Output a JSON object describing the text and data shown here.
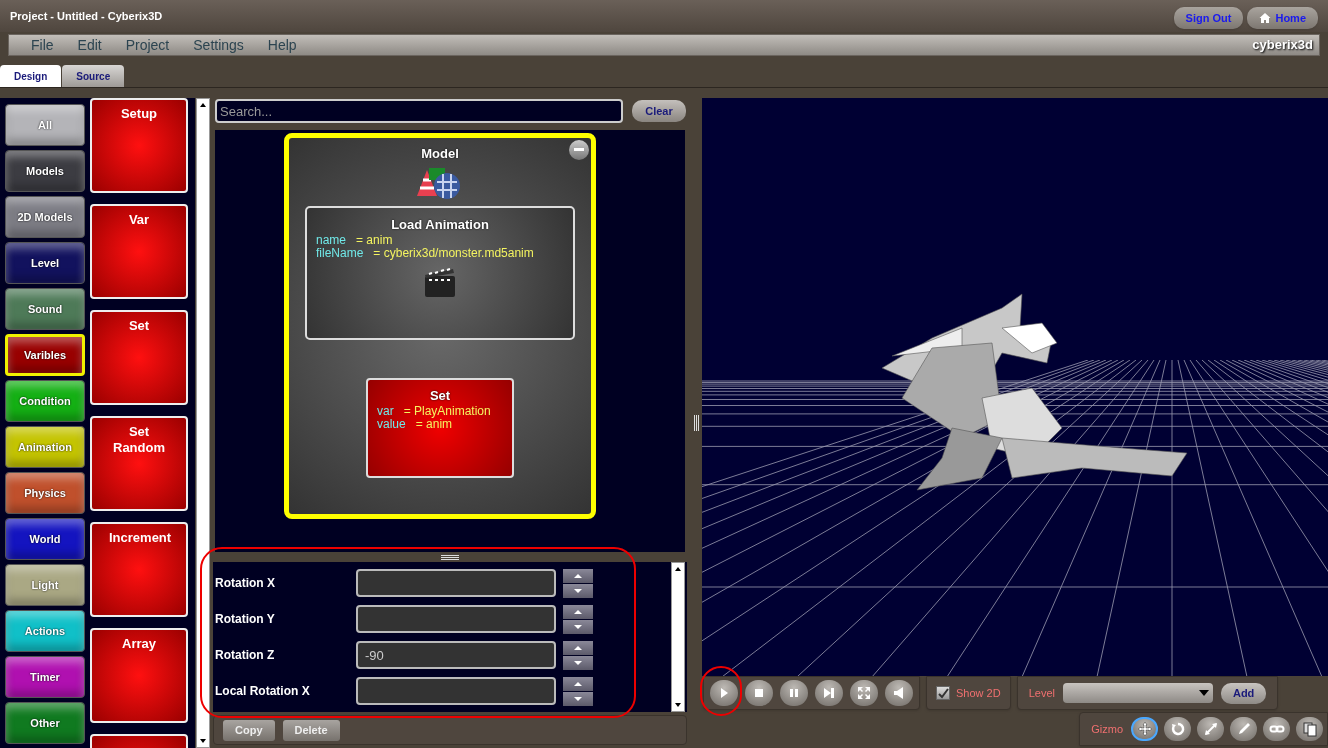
{
  "window": {
    "title": "Project - Untitled - Cyberix3D"
  },
  "header_buttons": [
    {
      "kind": "text",
      "label": "Sign Out"
    },
    {
      "kind": "home",
      "label": "Home"
    }
  ],
  "menu": [
    "File",
    "Edit",
    "Project",
    "Settings",
    "Help"
  ],
  "brand": "cyberix3d",
  "tabs": [
    {
      "label": "Design",
      "selected": true
    },
    {
      "label": "Source",
      "selected": false
    }
  ],
  "categories": [
    {
      "label": "All",
      "color": "#b4b4b8",
      "selected": false
    },
    {
      "label": "Models",
      "color": "#3c3c42",
      "selected": false
    },
    {
      "label": "2D Models",
      "color": "#7c7c84",
      "selected": false
    },
    {
      "label": "Level",
      "color": "#12125e",
      "selected": false
    },
    {
      "label": "Sound",
      "color": "#4e7a58",
      "selected": false
    },
    {
      "label": "Varibles",
      "color": "#990000",
      "selected": true
    },
    {
      "label": "Condition",
      "color": "#14b014",
      "selected": false
    },
    {
      "label": "Animation",
      "color": "#c4c400",
      "selected": false
    },
    {
      "label": "Physics",
      "color": "#c0502c",
      "selected": false
    },
    {
      "label": "World",
      "color": "#1414c0",
      "selected": false
    },
    {
      "label": "Light",
      "color": "#aaa884",
      "selected": false
    },
    {
      "label": "Actions",
      "color": "#10c0c8",
      "selected": false
    },
    {
      "label": "Timer",
      "color": "#b010b0",
      "selected": false
    },
    {
      "label": "Other",
      "color": "#107a20",
      "selected": false
    }
  ],
  "blocks": [
    {
      "title": "Setup"
    },
    {
      "title": "Var"
    },
    {
      "title": "Set"
    },
    {
      "title": "Set Random"
    },
    {
      "title": "Increment"
    },
    {
      "title": "Array"
    }
  ],
  "more_blocks_below": true,
  "search": {
    "placeholder": "Search..."
  },
  "clear_button": "Clear",
  "model": {
    "title": "Model",
    "blocks": [
      {
        "kind": "load",
        "title": "Load Animation",
        "params": [
          {
            "name": "name",
            "op": "=",
            "value": "anim"
          },
          {
            "name": "fileName",
            "op": "=",
            "value": "cyberix3d/monster.md5anim"
          }
        ]
      },
      {
        "kind": "set",
        "title": "Set",
        "params": [
          {
            "name": "var",
            "op": "=",
            "value": "PlayAnimation"
          },
          {
            "name": "value",
            "op": "=",
            "value": "anim"
          }
        ]
      }
    ]
  },
  "properties": [
    {
      "label": "Rotation X"
    },
    {
      "label": "Rotation Y"
    },
    {
      "label": "Rotation Z",
      "value": "-90"
    },
    {
      "label": "Local Rotation X"
    }
  ],
  "actions": [
    "Copy",
    "Delete"
  ],
  "playback": [
    {
      "kind": "play"
    },
    {
      "kind": "stop"
    },
    {
      "kind": "pause"
    },
    {
      "kind": "step"
    },
    {
      "kind": "fullscreen"
    },
    {
      "kind": "sound"
    }
  ],
  "show_2d": {
    "label": "Show 2D",
    "checked": true
  },
  "level": {
    "label": "Level",
    "add_button": "Add"
  },
  "gizmo": {
    "label": "Gizmo",
    "tools": [
      {
        "kind": "move",
        "selected": true
      },
      {
        "kind": "rotate",
        "selected": false
      },
      {
        "kind": "scale",
        "selected": false
      },
      {
        "kind": "pencil",
        "selected": false
      },
      {
        "kind": "link",
        "selected": false
      },
      {
        "kind": "copy",
        "selected": false
      }
    ]
  }
}
